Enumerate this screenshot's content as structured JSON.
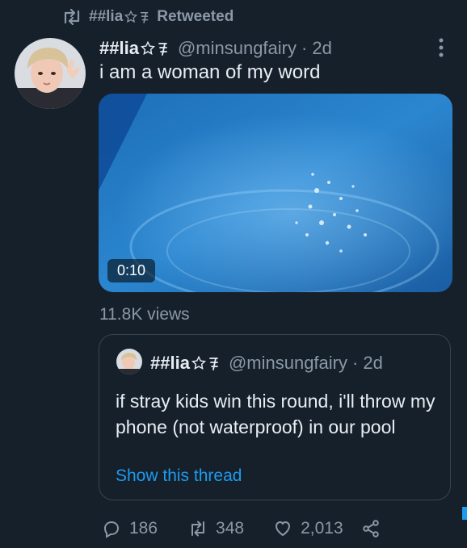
{
  "retweet_header": {
    "user": "##lia",
    "label": "Retweeted"
  },
  "tweet": {
    "display_name": "##lia",
    "handle": "@minsungfairy",
    "separator": "·",
    "time": "2d",
    "text": "i am a woman of my word",
    "media": {
      "duration": "0:10"
    },
    "views": "11.8K views"
  },
  "quoted_tweet": {
    "display_name": "##lia",
    "handle": "@minsungfairy",
    "separator": "·",
    "time": "2d",
    "text": "if stray kids win this round, i'll throw my phone (not waterproof) in our pool",
    "show_thread": "Show this thread"
  },
  "actions": {
    "replies": "186",
    "retweets": "348",
    "likes": "2,013"
  },
  "colors": {
    "background": "#15202b",
    "text": "#e8edf2",
    "muted": "#8b98a5",
    "link": "#1d9bf0",
    "border": "#38444d"
  },
  "icons": [
    "retweet-icon",
    "more-icon",
    "reply-icon",
    "like-icon",
    "share-icon",
    "star-icon",
    "sparkle-icon"
  ]
}
